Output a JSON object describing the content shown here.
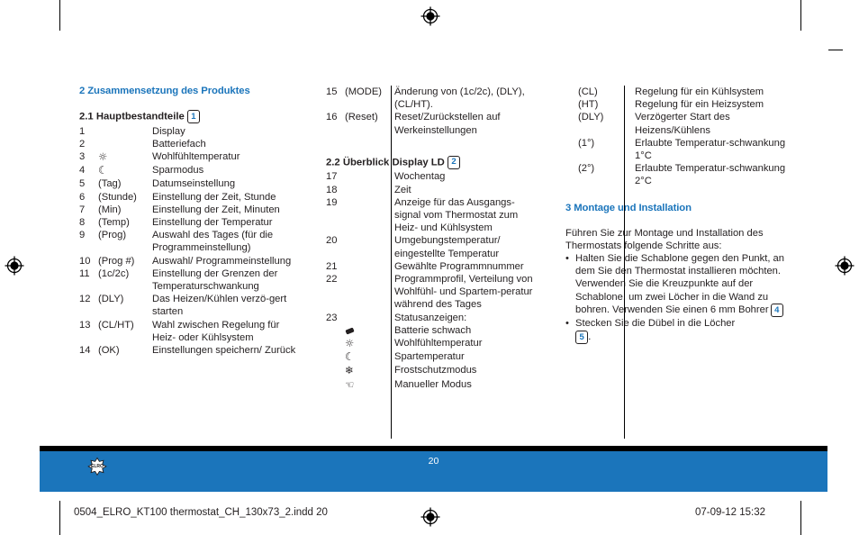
{
  "document": {
    "page_number": "20",
    "slug_left": "0504_ELRO_KT100 thermostat_CH_130x73_2.indd   20",
    "slug_right": "07-09-12   15:32",
    "logo_name": "ELRO",
    "accent_color": "#1b75bb",
    "text_color": "#231f20"
  },
  "column1": {
    "section_heading": "2 Zusammensetzung des Produktes",
    "subsection_heading": "2.1 Hauptbestandteile",
    "subsection_badge": "1",
    "items": [
      {
        "num": "1",
        "key": "",
        "icon": "",
        "desc": "Display"
      },
      {
        "num": "2",
        "key": "",
        "icon": "",
        "desc": "Batteriefach"
      },
      {
        "num": "3",
        "key": "",
        "icon": "sun-icon",
        "desc": "Wohlfühltemperatur"
      },
      {
        "num": "4",
        "key": "",
        "icon": "moon-icon",
        "desc": "Sparmodus"
      },
      {
        "num": "5",
        "key": "(Tag)",
        "icon": "",
        "desc": "Datumseinstellung"
      },
      {
        "num": "6",
        "key": "(Stunde)",
        "icon": "",
        "desc": "Einstellung der Zeit, Stunde"
      },
      {
        "num": "7",
        "key": "(Min)",
        "icon": "",
        "desc": "Einstellung der Zeit, Minuten"
      },
      {
        "num": "8",
        "key": "(Temp)",
        "icon": "",
        "desc": "Einstellung der Temperatur"
      },
      {
        "num": "9",
        "key": "(Prog)",
        "icon": "",
        "desc": "Auswahl des Tages (für die Programmeinstellung)"
      },
      {
        "num": "10",
        "key": "(Prog #)",
        "icon": "",
        "desc": "Auswahl/ Programmeinstellung"
      },
      {
        "num": "11",
        "key": "(1c/2c)",
        "icon": "",
        "desc": "Einstellung der Grenzen der Temperaturschwankung"
      },
      {
        "num": "12",
        "key": "(DLY)",
        "icon": "",
        "desc": "Das Heizen/Kühlen verzö-gert starten"
      },
      {
        "num": "13",
        "key": "(CL/HT)",
        "icon": "",
        "desc": "Wahl zwischen Regelung für Heiz- oder Kühlsystem"
      },
      {
        "num": "14",
        "key": "(OK)",
        "icon": "",
        "desc": "Einstellungen speichern/ Zurück"
      }
    ]
  },
  "column2": {
    "items_top": [
      {
        "num": "15",
        "key": "(MODE)",
        "desc": "Änderung von (1c/2c), (DLY), (CL/HT)."
      },
      {
        "num": "16",
        "key": "(Reset)",
        "desc": "Reset/Zurückstellen auf Werkeinstellungen"
      }
    ],
    "subsection_heading": "2.2 Überblick Display LD",
    "subsection_badge": "2",
    "items_bottom": [
      {
        "num": "17",
        "key": "",
        "icon": "",
        "desc": "Wochentag"
      },
      {
        "num": "18",
        "key": "",
        "icon": "",
        "desc": "Zeit"
      },
      {
        "num": "19",
        "key": "",
        "icon": "",
        "desc": "Anzeige für das Ausgangs-signal vom Thermostat zum Heiz- und Kühlsystem"
      },
      {
        "num": "20",
        "key": "",
        "icon": "",
        "desc": "Umgebungstemperatur/ eingestellte Temperatur"
      },
      {
        "num": "21",
        "key": "",
        "icon": "",
        "desc": "Gewählte Programmnummer"
      },
      {
        "num": "22",
        "key": "",
        "icon": "",
        "desc": "Programmprofil, Verteilung von Wohlfühl- und Spartem-peratur während des Tages"
      },
      {
        "num": "23",
        "key": "",
        "icon": "",
        "desc": "Statusanzeigen:"
      },
      {
        "num": "",
        "key": "",
        "icon": "battery-low-icon",
        "desc": "Batterie schwach"
      },
      {
        "num": "",
        "key": "",
        "icon": "sun-icon",
        "desc": "Wohlfühltemperatur"
      },
      {
        "num": "",
        "key": "",
        "icon": "moon-icon",
        "desc": "Spartemperatur"
      },
      {
        "num": "",
        "key": "",
        "icon": "snowflake-icon",
        "desc": "Frostschutzmodus"
      },
      {
        "num": "",
        "key": "",
        "icon": "hand-icon",
        "desc": "Manueller Modus"
      }
    ]
  },
  "column3": {
    "items": [
      {
        "key": "(CL)",
        "desc": "Regelung für ein Kühlsystem"
      },
      {
        "key": "(HT)",
        "desc": "Regelung für ein Heizsystem"
      },
      {
        "key": "(DLY)",
        "desc": "Verzögerter Start des Heizens/Kühlens"
      },
      {
        "key": "(1°)",
        "desc": "Erlaubte Temperatur-schwankung 1°C"
      },
      {
        "key": "(2°)",
        "desc": "Erlaubte Temperatur-schwankung 2°C"
      }
    ],
    "section_heading": "3 Montage und Installation",
    "intro": "Führen Sie zur Montage und Installation des Thermostats folgende Schritte aus:",
    "bullets": [
      {
        "text_before": "Halten Sie die Schablone gegen den Punkt, an dem Sie den Thermostat installieren möchten. Verwenden Sie die Kreuzpunkte auf der Schablone, um zwei Löcher in die Wand zu bohren. Verwenden Sie einen 6 mm Bohrer",
        "badge": "4",
        "text_after": ""
      },
      {
        "text_before": "Stecken Sie die Dübel in die Löcher",
        "badge": "5",
        "text_after": "."
      }
    ],
    "bullet_marker": "•"
  }
}
